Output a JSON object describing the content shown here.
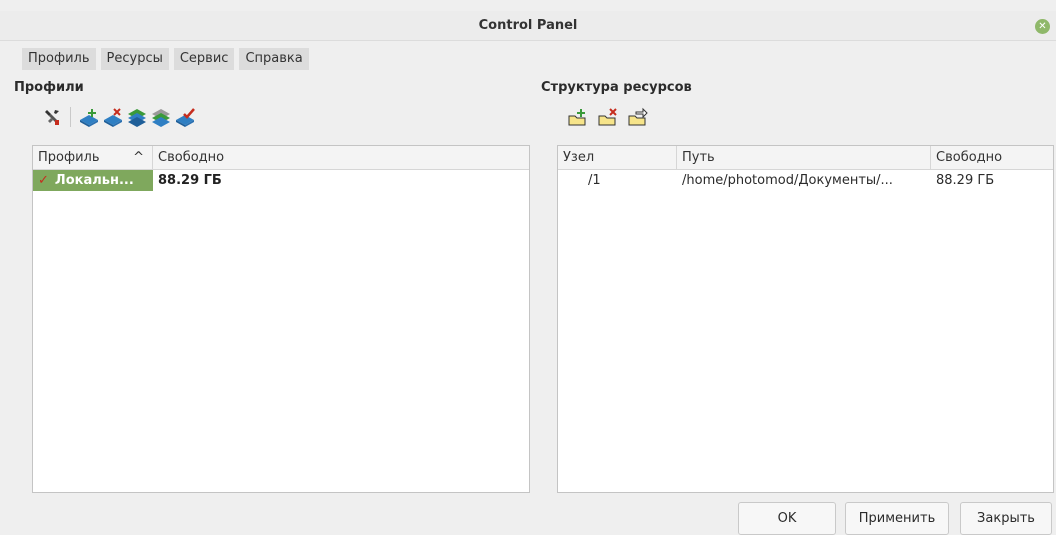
{
  "window": {
    "title": "Control Panel"
  },
  "menu": [
    "Профиль",
    "Ресурсы",
    "Сервис",
    "Справка"
  ],
  "profiles": {
    "title": "Профили",
    "toolbar_icons": [
      "settings-tools-icon",
      "add-profile-icon",
      "delete-profile-icon",
      "profile-stack-green-icon",
      "profile-stack-gray-icon",
      "activate-profile-icon"
    ],
    "columns": {
      "profile": "Профиль",
      "sort": "^",
      "free": "Свободно"
    },
    "rows": [
      {
        "check": "✓",
        "name": "Локальн...",
        "free": "88.29 ГБ"
      }
    ]
  },
  "resources": {
    "title": "Структура ресурсов",
    "toolbar_icons": [
      "add-folder-icon",
      "delete-folder-icon",
      "edit-folder-icon"
    ],
    "columns": {
      "node": "Узел",
      "path": "Путь",
      "free": "Свободно"
    },
    "rows": [
      {
        "node": "/1",
        "path": "/home/photomod/Документы/...",
        "free": "88.29 ГБ"
      }
    ]
  },
  "buttons": {
    "ok": "OK",
    "apply": "Применить",
    "close": "Закрыть"
  },
  "colors": {
    "selection": "#7fa85d",
    "check": "#c62d1e",
    "accent_blue": "#2f7fc3"
  }
}
